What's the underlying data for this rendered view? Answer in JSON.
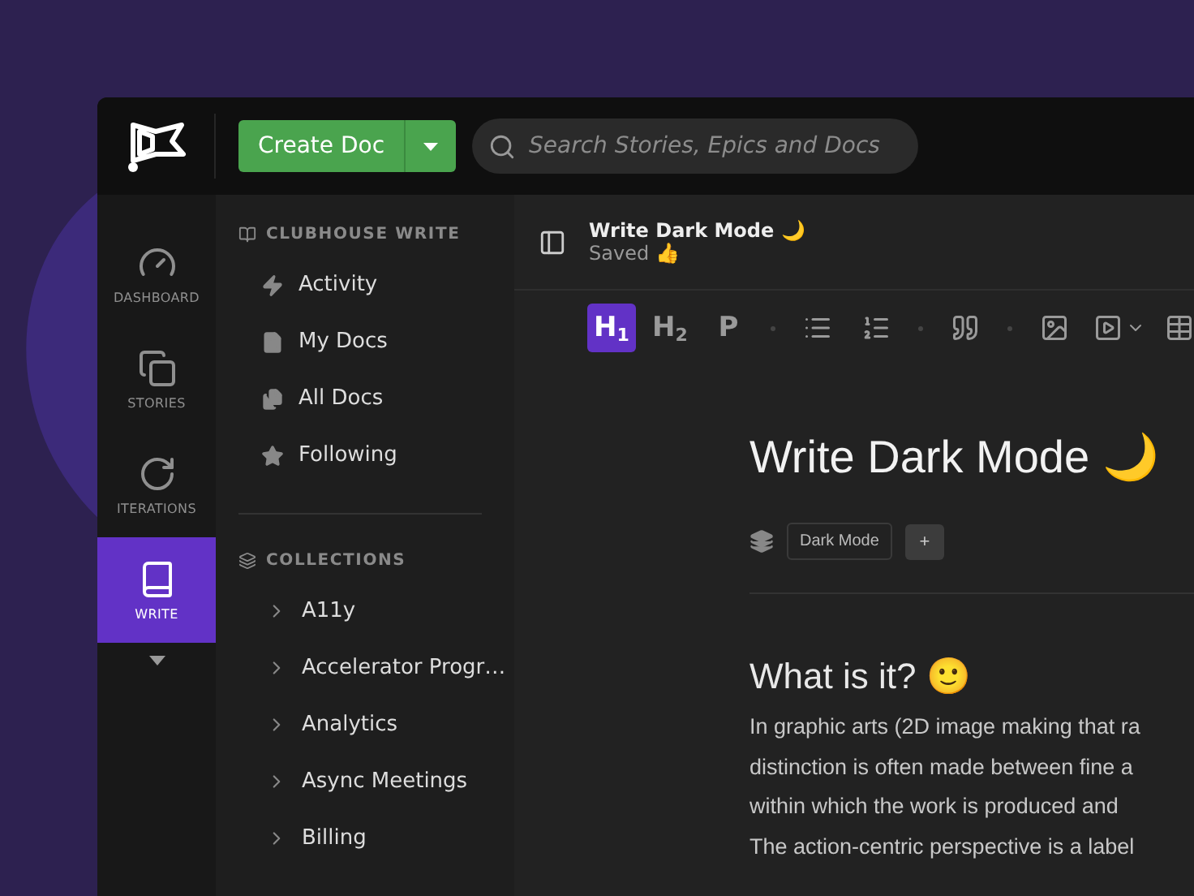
{
  "topbar": {
    "create_button": "Create Doc",
    "search": {
      "placeholder": "Search Stories, Epics and Docs"
    }
  },
  "rail": {
    "items": [
      {
        "kind": "dashboard",
        "label": "DASHBOARD",
        "selected": false
      },
      {
        "kind": "stories",
        "label": "STORIES",
        "selected": false
      },
      {
        "kind": "iterations",
        "label": "ITERATIONS",
        "selected": false
      },
      {
        "kind": "write",
        "label": "WRITE",
        "selected": true
      }
    ]
  },
  "sidebar": {
    "sections": [
      {
        "kind": "write",
        "title": "CLUBHOUSE WRITE",
        "items": [
          {
            "kind": "activity",
            "label": "Activity"
          },
          {
            "kind": "my-docs",
            "label": "My Docs"
          },
          {
            "kind": "all-docs",
            "label": "All Docs"
          },
          {
            "kind": "following",
            "label": "Following"
          }
        ]
      },
      {
        "kind": "collections",
        "title": "COLLECTIONS",
        "items": [
          {
            "kind": "collection",
            "label": "A11y"
          },
          {
            "kind": "collection",
            "label": "Accelerator Progr…"
          },
          {
            "kind": "collection",
            "label": "Analytics"
          },
          {
            "kind": "collection",
            "label": "Async Meetings"
          },
          {
            "kind": "collection",
            "label": "Billing"
          }
        ]
      }
    ]
  },
  "doc_header": {
    "title": "Write Dark Mode 🌙",
    "status": "Saved 👍"
  },
  "toolbar": {
    "groups": [
      {
        "items": [
          {
            "kind": "text",
            "label": "H$_{1}$",
            "selected": true
          },
          {
            "kind": "text",
            "label": "H$_{2}$",
            "selected": false
          },
          {
            "kind": "text",
            "label": "P",
            "selected": false
          }
        ]
      },
      {
        "items": [
          {
            "kind": "bullet-list",
            "selected": false
          },
          {
            "kind": "ordered-list",
            "selected": false
          }
        ]
      },
      {
        "items": [
          {
            "kind": "quote",
            "selected": false
          }
        ]
      },
      {
        "items": [
          {
            "kind": "image",
            "selected": false
          },
          {
            "kind": "video",
            "selected": false
          },
          {
            "kind": "table",
            "selected": false
          }
        ]
      }
    ]
  },
  "document": {
    "title": "Write Dark Mode 🌙",
    "tags": [
      "Dark Mode"
    ],
    "add_tag": "+",
    "heading": "What is it? 🙂",
    "lines": [
      "In graphic arts (2D image making that ra",
      "distinction is often made between fine a",
      "within which the work is produced and",
      "The action-centric perspective is a label"
    ]
  }
}
